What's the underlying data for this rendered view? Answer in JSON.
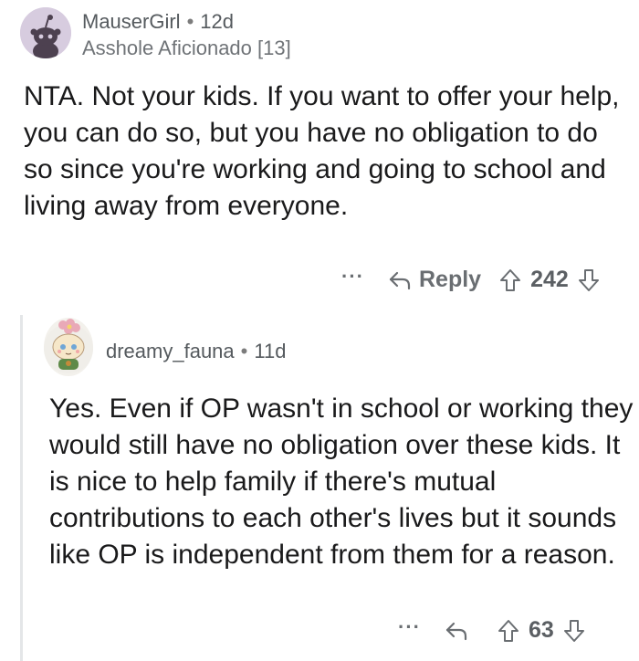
{
  "comment": {
    "username": "MauserGirl",
    "time": "12d",
    "flair": "Asshole Aficionado [13]",
    "body": "NTA. Not your kids. If you want to offer your help, you can do so, but you have no obligation to do so since you're working and going to school and living away from everyone.",
    "more": "···",
    "reply_label": "Reply",
    "score": "242"
  },
  "reply": {
    "username": "dreamy_fauna",
    "time": "11d",
    "body": "Yes. Even if OP wasn't in school or working  they would still have no obligation over these kids. It is nice to help family if there's mutual contributions to each other's lives but it sounds like OP is independent from them for a reason.",
    "more": "···",
    "score": "63"
  },
  "colors": {
    "text": "#1a1a1b",
    "meta": "#555a5e",
    "action": "#6a6e72",
    "thread_line": "#e4e6e8",
    "avatar_bg": "#d7ccdf"
  },
  "icons": [
    "reddit-snoo-avatar-icon",
    "reply-arrow-icon",
    "upvote-arrow-icon",
    "downvote-arrow-icon",
    "more-options-icon"
  ]
}
